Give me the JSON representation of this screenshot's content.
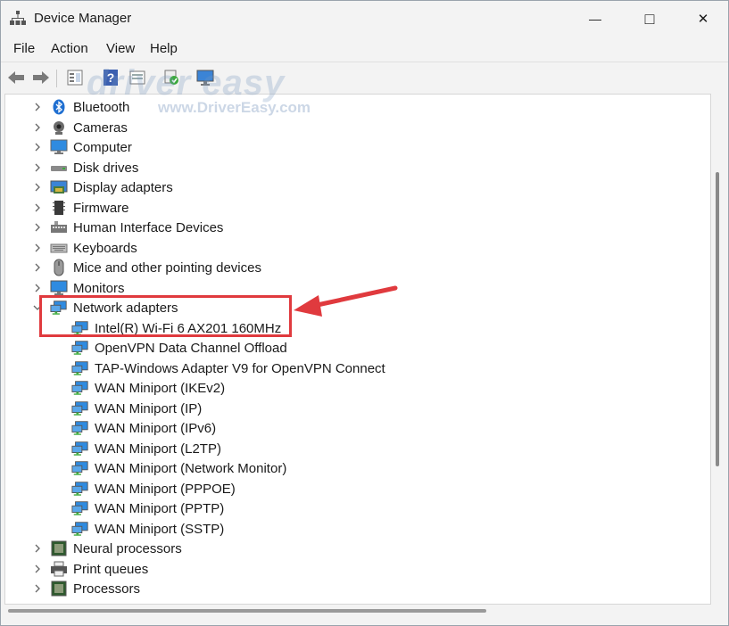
{
  "window": {
    "title": "Device Manager"
  },
  "titlebar": {
    "minimize_glyph": "—",
    "maximize_glyph": "□",
    "close_glyph": "✕"
  },
  "menu": {
    "items": [
      "File",
      "Action",
      "View",
      "Help"
    ]
  },
  "watermark": {
    "logo": "driver easy",
    "url": "www.DriverEasy.com"
  },
  "tree": {
    "items": [
      {
        "label": "Bluetooth",
        "icon": "bluetooth-icon"
      },
      {
        "label": "Cameras",
        "icon": "camera-icon"
      },
      {
        "label": "Computer",
        "icon": "computer-icon"
      },
      {
        "label": "Disk drives",
        "icon": "disk-drive-icon"
      },
      {
        "label": "Display adapters",
        "icon": "display-adapter-icon"
      },
      {
        "label": "Firmware",
        "icon": "firmware-icon"
      },
      {
        "label": "Human Interface Devices",
        "icon": "hid-icon"
      },
      {
        "label": "Keyboards",
        "icon": "keyboard-icon"
      },
      {
        "label": "Mice and other pointing devices",
        "icon": "mouse-icon"
      },
      {
        "label": "Monitors",
        "icon": "monitor-icon"
      },
      {
        "label": "Network adapters",
        "icon": "network-adapter-icon",
        "expanded": true
      },
      {
        "label": "Neural processors",
        "icon": "chip-icon"
      },
      {
        "label": "Print queues",
        "icon": "printer-icon"
      },
      {
        "label": "Processors",
        "icon": "chip-icon"
      }
    ],
    "network_children": [
      "Intel(R) Wi-Fi 6 AX201 160MHz",
      "OpenVPN Data Channel Offload",
      "TAP-Windows Adapter V9 for OpenVPN Connect",
      "WAN Miniport (IKEv2)",
      "WAN Miniport (IP)",
      "WAN Miniport (IPv6)",
      "WAN Miniport (L2TP)",
      "WAN Miniport (Network Monitor)",
      "WAN Miniport (PPPOE)",
      "WAN Miniport (PPTP)",
      "WAN Miniport (SSTP)"
    ]
  },
  "colors": {
    "highlight": "#e03a3e",
    "accent": "#2f7fd8"
  }
}
